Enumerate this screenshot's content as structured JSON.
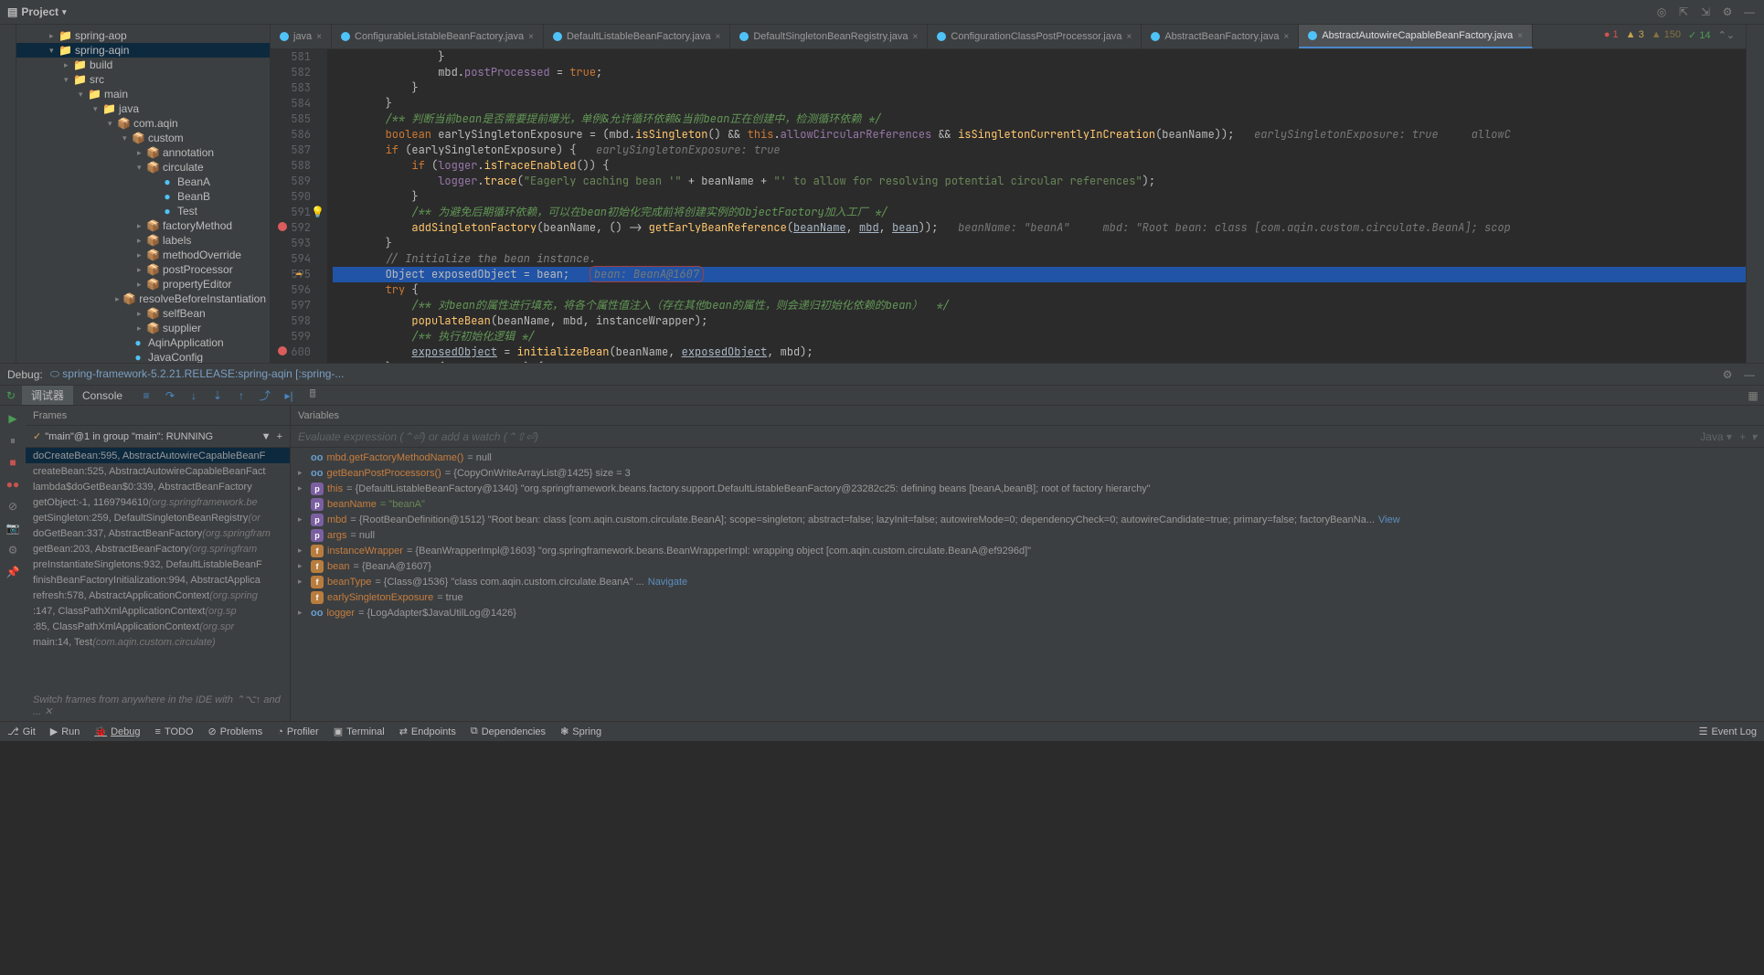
{
  "topbar": {
    "project_label": "Project"
  },
  "tree": [
    {
      "indent": 32,
      "arrow": "▸",
      "icon": "📁",
      "cls": "folder-icon",
      "label": "spring-aop"
    },
    {
      "indent": 32,
      "arrow": "▾",
      "icon": "📁",
      "cls": "folder-icon",
      "label": "spring-aqin",
      "selected": true
    },
    {
      "indent": 48,
      "arrow": "▸",
      "icon": "📁",
      "cls": "build-icon",
      "label": "build"
    },
    {
      "indent": 48,
      "arrow": "▾",
      "icon": "📁",
      "cls": "folder-icon",
      "label": "src"
    },
    {
      "indent": 64,
      "arrow": "▾",
      "icon": "📁",
      "cls": "folder-icon",
      "label": "main"
    },
    {
      "indent": 80,
      "arrow": "▾",
      "icon": "📁",
      "cls": "folder-icon",
      "label": "java"
    },
    {
      "indent": 96,
      "arrow": "▾",
      "icon": "📦",
      "cls": "package-icon",
      "label": "com.aqin"
    },
    {
      "indent": 112,
      "arrow": "▾",
      "icon": "📦",
      "cls": "package-icon",
      "label": "custom"
    },
    {
      "indent": 128,
      "arrow": "▸",
      "icon": "📦",
      "cls": "package-icon",
      "label": "annotation"
    },
    {
      "indent": 128,
      "arrow": "▾",
      "icon": "📦",
      "cls": "package-icon",
      "label": "circulate"
    },
    {
      "indent": 144,
      "arrow": "",
      "icon": "●",
      "cls": "class-icon",
      "label": "BeanA"
    },
    {
      "indent": 144,
      "arrow": "",
      "icon": "●",
      "cls": "class-icon",
      "label": "BeanB"
    },
    {
      "indent": 144,
      "arrow": "",
      "icon": "●",
      "cls": "class-icon",
      "label": "Test"
    },
    {
      "indent": 128,
      "arrow": "▸",
      "icon": "📦",
      "cls": "package-icon",
      "label": "factoryMethod"
    },
    {
      "indent": 128,
      "arrow": "▸",
      "icon": "📦",
      "cls": "package-icon",
      "label": "labels"
    },
    {
      "indent": 128,
      "arrow": "▸",
      "icon": "📦",
      "cls": "package-icon",
      "label": "methodOverride"
    },
    {
      "indent": 128,
      "arrow": "▸",
      "icon": "📦",
      "cls": "package-icon",
      "label": "postProcessor"
    },
    {
      "indent": 128,
      "arrow": "▸",
      "icon": "📦",
      "cls": "package-icon",
      "label": "propertyEditor"
    },
    {
      "indent": 128,
      "arrow": "▸",
      "icon": "📦",
      "cls": "package-icon",
      "label": "resolveBeforeInstantiation"
    },
    {
      "indent": 128,
      "arrow": "▸",
      "icon": "📦",
      "cls": "package-icon",
      "label": "selfBean"
    },
    {
      "indent": 128,
      "arrow": "▸",
      "icon": "📦",
      "cls": "package-icon",
      "label": "supplier"
    },
    {
      "indent": 112,
      "arrow": "",
      "icon": "●",
      "cls": "class-icon",
      "label": "AqinApplication"
    },
    {
      "indent": 112,
      "arrow": "",
      "icon": "●",
      "cls": "class-icon",
      "label": "JavaConfig"
    }
  ],
  "tabs": [
    {
      "label": "java",
      "active": false
    },
    {
      "label": "ConfigurableListableBeanFactory.java",
      "active": false
    },
    {
      "label": "DefaultListableBeanFactory.java",
      "active": false
    },
    {
      "label": "DefaultSingletonBeanRegistry.java",
      "active": false
    },
    {
      "label": "ConfigurationClassPostProcessor.java",
      "active": false
    },
    {
      "label": "AbstractBeanFactory.java",
      "active": false
    },
    {
      "label": "AbstractAutowireCapableBeanFactory.java",
      "active": true
    }
  ],
  "inspect": {
    "errors": "1",
    "warnings": "3",
    "weak": "150",
    "ok": "14"
  },
  "gutter_start": 581,
  "gutter_count": 21,
  "code_lines": [
    {
      "html": "                }"
    },
    {
      "html": "                mbd.<span class='field'>postProcessed</span> = <span class='kw'>true</span>;"
    },
    {
      "html": "            }"
    },
    {
      "html": "        }"
    },
    {
      "html": "        <span class='doc'>/** 判断当前bean是否需要提前曝光，单例&允许循环依赖&当前bean正在创建中，检测循环依赖 */</span>"
    },
    {
      "html": "        <span class='kw'>boolean</span> earlySingletonExposure = (mbd.<span class='method'>isSingleton</span>() && <span class='kw'>this</span>.<span class='field'>allowCircularReferences</span> && <span class='method'>isSingletonCurrentlyInCreation</span>(beanName));   <span class='hint'>earlySingletonExposure: true     allowC</span>"
    },
    {
      "html": "        <span class='kw'>if</span> (earlySingletonExposure) {   <span class='hint'>earlySingletonExposure: true</span>"
    },
    {
      "html": "            <span class='kw'>if</span> (<span class='field'>logger</span>.<span class='method'>isTraceEnabled</span>()) {"
    },
    {
      "html": "                <span class='field'>logger</span>.<span class='method'>trace</span>(<span class='str'>\"Eagerly caching bean '\"</span> + beanName + <span class='str'>\"' to allow for resolving potential circular references\"</span>);"
    },
    {
      "html": "            }"
    },
    {
      "html": "            <span class='doc'>/** 为避免后期循环依赖，可以在bean初始化完成前将创建实例的ObjectFactory加入工厂 */</span>"
    },
    {
      "html": "            <span class='method'>addSingletonFactory</span>(beanName, () -> <span class='method'>getEarlyBeanReference</span>(<span class='param'>beanName</span>, <span class='param'>mbd</span>, <span class='param'>bean</span>));   <span class='hint'>beanName: \"beanA\"     mbd: \"Root bean: class [com.aqin.custom.circulate.BeanA]; scop</span>"
    },
    {
      "html": "        }"
    },
    {
      "html": "        <span class='cmt'>// Initialize the bean instance.</span>"
    },
    {
      "html": "        Object exposedObject = bean;   <span class='hint hint-box'>bean: BeanA@1607</span>",
      "current": true
    },
    {
      "html": "        <span class='kw'>try</span> {"
    },
    {
      "html": "            <span class='doc'>/** 对bean的属性进行填充，将各个属性值注入（存在其他bean的属性，则会递归初始化依赖的bean）  */</span>"
    },
    {
      "html": "            <span class='method'>populateBean</span>(beanName, mbd, instanceWrapper);"
    },
    {
      "html": "            <span class='doc'>/** 执行初始化逻辑 */</span>"
    },
    {
      "html": "            <span class='param'>exposedObject</span> = <span class='method'>initializeBean</span>(beanName, <span class='param'>exposedObject</span>, mbd);"
    },
    {
      "html": "        } <span class='kw'>catch</span> (Throwable ex) {"
    }
  ],
  "debug": {
    "title": "Debug:",
    "config": "spring-framework-5.2.21.RELEASE:spring-aqin [:spring-...",
    "tab_debugger": "调试器",
    "tab_console": "Console",
    "frames_label": "Frames",
    "variables_label": "Variables",
    "thread": "\"main\"@1 in group \"main\": RUNNING",
    "eval_placeholder": "Evaluate expression (⌃⏎) or add a watch (⌃⇧⏎)",
    "frames": [
      {
        "label": "doCreateBean:595, AbstractAutowireCapableBeanF",
        "selected": true
      },
      {
        "label": "createBean:525, AbstractAutowireCapableBeanFact"
      },
      {
        "label": "lambda$doGetBean$0:339, AbstractBeanFactory",
        "pkg": ""
      },
      {
        "label": "getObject:-1, 1169794610",
        "pkg": "(org.springframework.be"
      },
      {
        "label": "getSingleton:259, DefaultSingletonBeanRegistry",
        "pkg": "(or"
      },
      {
        "label": "doGetBean:337, AbstractBeanFactory",
        "pkg": "(org.springfram"
      },
      {
        "label": "getBean:203, AbstractBeanFactory",
        "pkg": "(org.springfram"
      },
      {
        "label": "preInstantiateSingletons:932, DefaultListableBeanF"
      },
      {
        "label": "finishBeanFactoryInitialization:994, AbstractApplica"
      },
      {
        "label": "refresh:578, AbstractApplicationContext",
        "pkg": "(org.spring"
      },
      {
        "label": "<init>:147, ClassPathXmlApplicationContext",
        "pkg": "(org.sp"
      },
      {
        "label": "<init>:85, ClassPathXmlApplicationContext",
        "pkg": "(org.spr"
      },
      {
        "label": "main:14, Test",
        "pkg": "(com.aqin.custom.circulate)"
      }
    ],
    "vars": [
      {
        "arrow": "",
        "icon": "oo",
        "name": "mbd.getFactoryMethodName()",
        "val": " = null"
      },
      {
        "arrow": "▸",
        "icon": "oo",
        "name": "getBeanPostProcessors()",
        "val": " = {CopyOnWriteArrayList@1425}  size = 3"
      },
      {
        "arrow": "▸",
        "icon": "p",
        "name": "this",
        "val": " = {DefaultListableBeanFactory@1340} \"org.springframework.beans.factory.support.DefaultListableBeanFactory@23282c25: defining beans [beanA,beanB]; root of factory hierarchy\""
      },
      {
        "arrow": "",
        "icon": "p",
        "name": "beanName",
        "valStr": " = \"beanA\""
      },
      {
        "arrow": "▸",
        "icon": "p",
        "name": "mbd",
        "val": " = {RootBeanDefinition@1512} \"Root bean: class [com.aqin.custom.circulate.BeanA]; scope=singleton; abstract=false; lazyInit=false; autowireMode=0; dependencyCheck=0; autowireCandidate=true; primary=false; factoryBeanNa...",
        "link": "View"
      },
      {
        "arrow": "",
        "icon": "p",
        "name": "args",
        "val": " = null"
      },
      {
        "arrow": "▸",
        "icon": "f",
        "name": "instanceWrapper",
        "val": " = {BeanWrapperImpl@1603} \"org.springframework.beans.BeanWrapperImpl: wrapping object [com.aqin.custom.circulate.BeanA@ef9296d]\""
      },
      {
        "arrow": "▸",
        "icon": "f",
        "name": "bean",
        "val": " = {BeanA@1607}"
      },
      {
        "arrow": "▸",
        "icon": "f",
        "name": "beanType",
        "val": " = {Class@1536} \"class com.aqin.custom.circulate.BeanA\" ... ",
        "link": "Navigate"
      },
      {
        "arrow": "",
        "icon": "f",
        "name": "earlySingletonExposure",
        "val": " = true"
      },
      {
        "arrow": "▸",
        "icon": "oo",
        "name": "logger",
        "val": " = {LogAdapter$JavaUtilLog@1426}"
      }
    ],
    "hint": "Switch frames from anywhere in the IDE with ⌃⌥↑ and ..."
  },
  "bottom": {
    "git": "Git",
    "run": "Run",
    "debug": "Debug",
    "todo": "TODO",
    "problems": "Problems",
    "profiler": "Profiler",
    "terminal": "Terminal",
    "endpoints": "Endpoints",
    "dependencies": "Dependencies",
    "spring": "Spring",
    "event_log": "Event Log"
  },
  "eval_lang": "Java"
}
